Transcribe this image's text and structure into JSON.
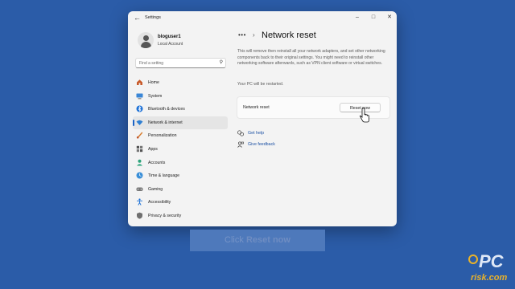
{
  "window": {
    "title": "Settings"
  },
  "account": {
    "name": "bloguser1",
    "type": "Local Account"
  },
  "search": {
    "placeholder": "Find a setting"
  },
  "nav": [
    {
      "label": "Home"
    },
    {
      "label": "System"
    },
    {
      "label": "Bluetooth & devices"
    },
    {
      "label": "Network & internet",
      "selected": true
    },
    {
      "label": "Personalization"
    },
    {
      "label": "Apps"
    },
    {
      "label": "Accounts"
    },
    {
      "label": "Time & language"
    },
    {
      "label": "Gaming"
    },
    {
      "label": "Accessibility"
    },
    {
      "label": "Privacy & security"
    }
  ],
  "breadcrumb": {
    "more": "•••",
    "separator": "›"
  },
  "page": {
    "title": "Network reset",
    "description": "This will remove then reinstall all your network adapters, and set other networking components back to their original settings. You might need to reinstall other networking software afterwards, such as VPN client software or virtual switches.",
    "restart_note": "Your PC will be restarted.",
    "card": {
      "label": "Network reset",
      "button": "Reset now"
    },
    "links": {
      "help": "Get help",
      "feedback": "Give feedback"
    }
  },
  "overlay": {
    "caption_prefix": "Click ",
    "caption_emphasis": "Reset now"
  },
  "logo": {
    "main": "PC",
    "sub": "risk.com"
  },
  "colors": {
    "background": "#2b5ca8",
    "accent": "#1a63c6",
    "link": "#1a4fa3"
  }
}
